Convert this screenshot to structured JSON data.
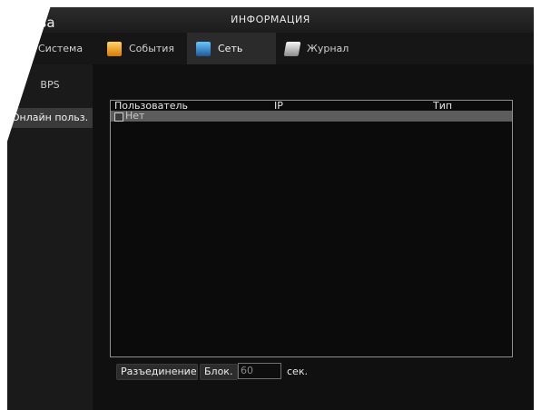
{
  "window": {
    "pause_label": "Пауза",
    "title": "ИНФОРМАЦИЯ"
  },
  "tabs": [
    {
      "label": "Система"
    },
    {
      "label": "События"
    },
    {
      "label": "Сеть"
    },
    {
      "label": "Журнал"
    }
  ],
  "subnav": {
    "items": [
      {
        "label": "BPS"
      },
      {
        "label": "Онлайн польз."
      }
    ]
  },
  "table": {
    "headers": [
      "Пользователь",
      "IP",
      "Тип"
    ],
    "rows": [
      {
        "label": "Нет"
      }
    ]
  },
  "controls": {
    "disconnect": "Разъединение",
    "block": "Блок.",
    "seconds_value": "60",
    "seconds_unit": "сек."
  }
}
